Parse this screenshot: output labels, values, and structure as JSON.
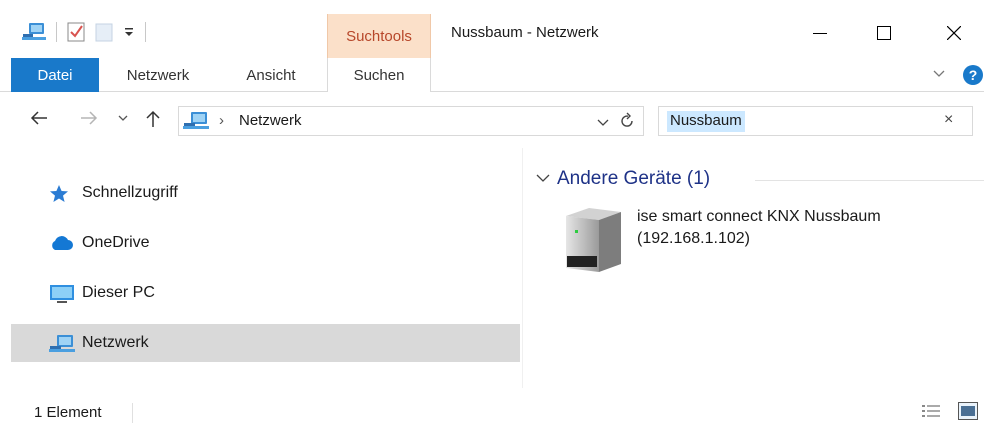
{
  "window": {
    "title": "Nussbaum - Netzwerk",
    "contextual_group": "Suchtools"
  },
  "ribbon": {
    "tabs": [
      {
        "label": "Datei"
      },
      {
        "label": "Netzwerk"
      },
      {
        "label": "Ansicht"
      },
      {
        "label": "Suchen"
      }
    ]
  },
  "address": {
    "crumb": "Netzwerk",
    "separator": "›"
  },
  "search": {
    "value": "Nussbaum",
    "clear_label": "×"
  },
  "nav": {
    "items": [
      {
        "label": "Schnellzugriff",
        "icon": "star-icon"
      },
      {
        "label": "OneDrive",
        "icon": "cloud-icon"
      },
      {
        "label": "Dieser PC",
        "icon": "monitor-icon"
      },
      {
        "label": "Netzwerk",
        "icon": "network-icon",
        "selected": true
      }
    ]
  },
  "content": {
    "group_title": "Andere Geräte (1)",
    "device": {
      "name": "ise smart connect KNX Nussbaum",
      "ip": "(192.168.1.102)",
      "icon": "server-icon"
    }
  },
  "status": {
    "count": "1 Element"
  },
  "colors": {
    "accent": "#1979ca",
    "contextual": "#fbe0c9",
    "contextual_text": "#b7472a",
    "group_title": "#1e3287",
    "selected": "#d9d9d9"
  }
}
